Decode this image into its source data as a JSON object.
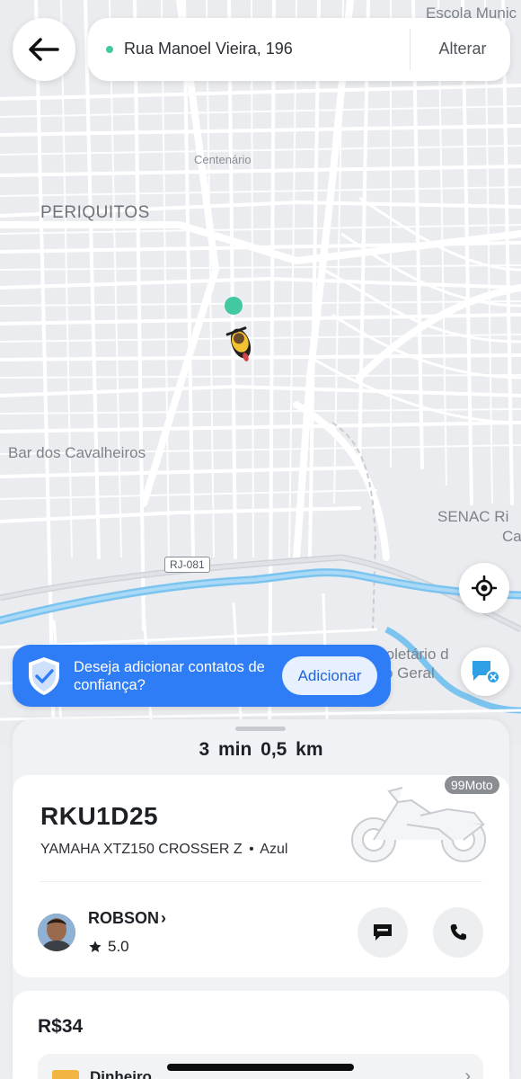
{
  "header": {
    "back_icon": "arrow-left-icon",
    "address": "Rua Manoel Vieira, 196",
    "change_label": "Alterar",
    "pickup_dot_color": "#42c9a1"
  },
  "map": {
    "labels": {
      "escola": "Escola Munic",
      "centenario": "Centenário",
      "periquitos": "PERIQUITOS",
      "bar": "Bar dos Cavalheiros",
      "senac": "SENAC Ri",
      "senac_line2": "Ca",
      "proletario": "roletário d",
      "geral": "o Geral"
    },
    "road_shield": "RJ-081",
    "driver_icon": "motorcycle-driver-icon",
    "pickup_marker_color": "#42c9a1"
  },
  "trust_banner": {
    "icon": "shield-check-icon",
    "text": "Deseja adicionar contatos de confiança?",
    "button_label": "Adicionar",
    "color": "#2f7df6"
  },
  "trip": {
    "eta": "3 min",
    "distance": "0,5 km"
  },
  "vehicle": {
    "badge": "99Moto",
    "plate": "RKU1D25",
    "model": "YAMAHA XTZ150 CROSSER Z",
    "separator": "•",
    "color": "Azul"
  },
  "driver": {
    "name": "ROBSON",
    "chevron": "›",
    "rating": "5.0",
    "star_icon": "star-icon",
    "message_icon": "message-icon",
    "phone_icon": "phone-icon"
  },
  "payment": {
    "price": "R$34",
    "method": "Dinheiro",
    "icon": "cash-icon"
  }
}
